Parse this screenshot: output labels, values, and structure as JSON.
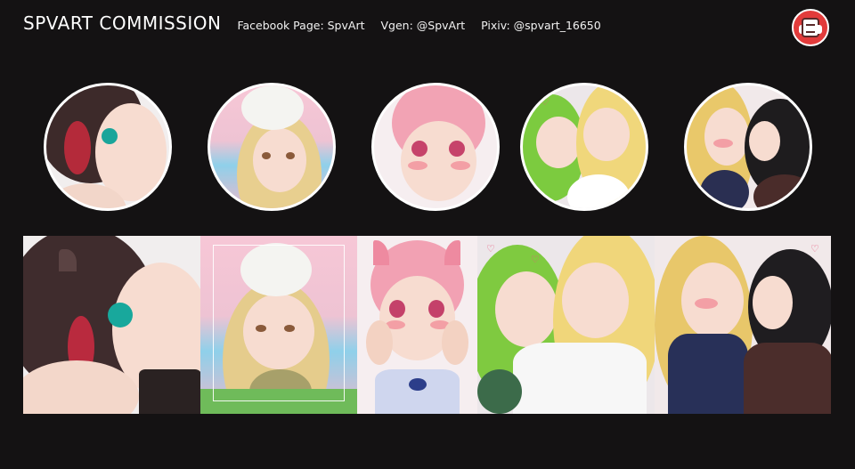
{
  "header": {
    "title": "SPVART COMMISSION",
    "facebook": "Facebook Page: SpvArt",
    "vgen": "Vgen: @SpvArt",
    "pixiv": "Pixiv: @spvart_16650"
  },
  "logo": {
    "icon": "spvart-logo-icon"
  },
  "colors": {
    "background": "#141213",
    "logo_red": "#e23b3b",
    "text": "#ffffff"
  },
  "artworks": [
    {
      "name": "dark-haired-catgirl",
      "icon": "portrait-icon"
    },
    {
      "name": "blonde-girl-sakura-bear",
      "icon": "portrait-icon"
    },
    {
      "name": "pink-haired-girl-squished-cheeks",
      "icon": "portrait-icon"
    },
    {
      "name": "green-and-blonde-couple",
      "icon": "portrait-icon"
    },
    {
      "name": "blonde-and-black-haired-couple",
      "icon": "portrait-icon"
    }
  ]
}
